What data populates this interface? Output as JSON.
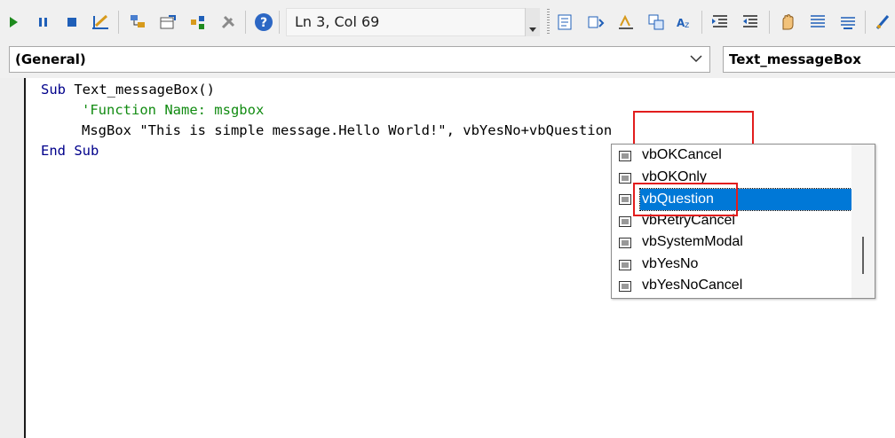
{
  "toolbar": {
    "status_text": "Ln 3, Col 69",
    "icons": [
      "run-icon",
      "pause-icon",
      "stop-icon",
      "design-mode-icon",
      "project-explorer-icon",
      "properties-icon",
      "object-browser-icon",
      "toolbox-icon",
      "help-icon",
      "list-properties-icon",
      "list-constants-icon",
      "quick-info-icon",
      "parameter-info-icon",
      "complete-word-icon",
      "indent-icon",
      "outdent-icon",
      "toggle-breakpoint-icon",
      "comment-block-icon",
      "uncomment-block-icon",
      "bookmark-icon"
    ]
  },
  "dropdowns": {
    "object": "(General)",
    "procedure": "Text_messageBox"
  },
  "code": {
    "line1_kw1": "Sub",
    "line1_rest": " Text_messageBox()",
    "line2_comment": "'Function Name: msgbox",
    "line3_text": "MsgBox \"This is simple message.Hello World!\", vbYesNo+vbQuestion",
    "line4_kw1": "End",
    "line4_kw2": "Sub"
  },
  "autocomplete": {
    "items": [
      {
        "label": "vbOKCancel"
      },
      {
        "label": "vbOKOnly"
      },
      {
        "label": "vbQuestion",
        "selected": true
      },
      {
        "label": "vbRetryCancel"
      },
      {
        "label": "vbSystemModal"
      },
      {
        "label": "vbYesNo"
      },
      {
        "label": "vbYesNoCancel"
      }
    ]
  },
  "colors": {
    "keyword": "#00008b",
    "comment": "#118b11",
    "selection": "#0078d7",
    "annotation": "#e21d1d"
  }
}
